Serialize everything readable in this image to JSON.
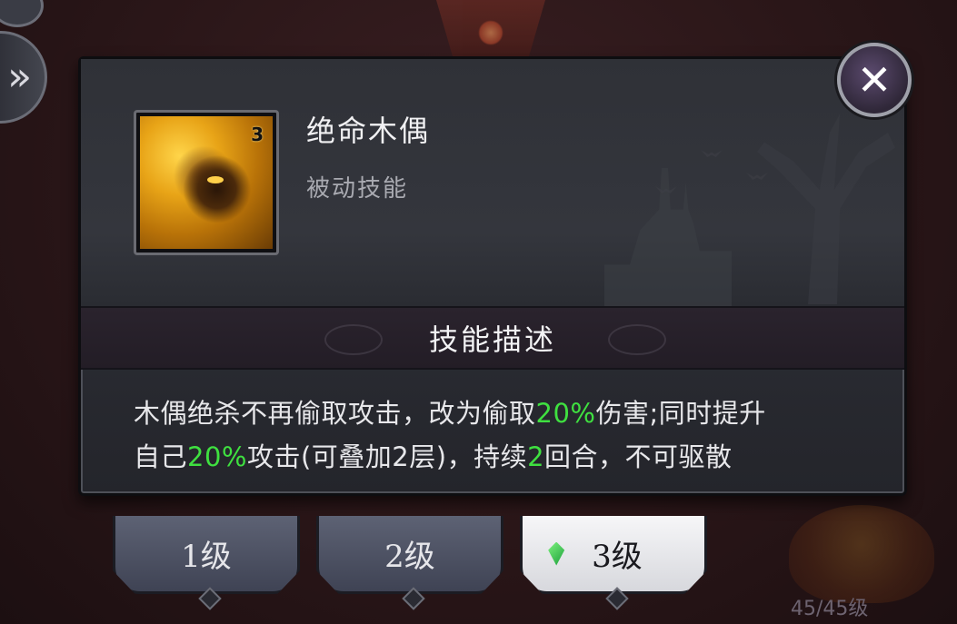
{
  "skill": {
    "name": "绝命木偶",
    "type": "被动技能",
    "icon_level": "3",
    "icon": "golden-puppet-icon"
  },
  "close_icon": "close-x-icon",
  "side_button_icon": "double-chevron-right-icon",
  "section": {
    "title": "技能描述"
  },
  "description": {
    "line1_a": "木偶绝杀不再偷取攻击，改为偷取",
    "line1_hl": "20%",
    "line1_b": "伤害;同时提升",
    "line2_a": "自己",
    "line2_hl1": "20%",
    "line2_b": "攻击(可叠加2层)，持续",
    "line2_hl2": "2",
    "line2_c": "回合，不可驱散"
  },
  "level_tabs": [
    {
      "label": "1级",
      "active": false
    },
    {
      "label": "2级",
      "active": false
    },
    {
      "label": "3级",
      "active": true,
      "icon": "green-gem-icon"
    }
  ],
  "hero_level": "45/45级",
  "colors": {
    "highlight": "#3fe040",
    "panel": "#2c2e35",
    "text": "#e7e7ea"
  }
}
